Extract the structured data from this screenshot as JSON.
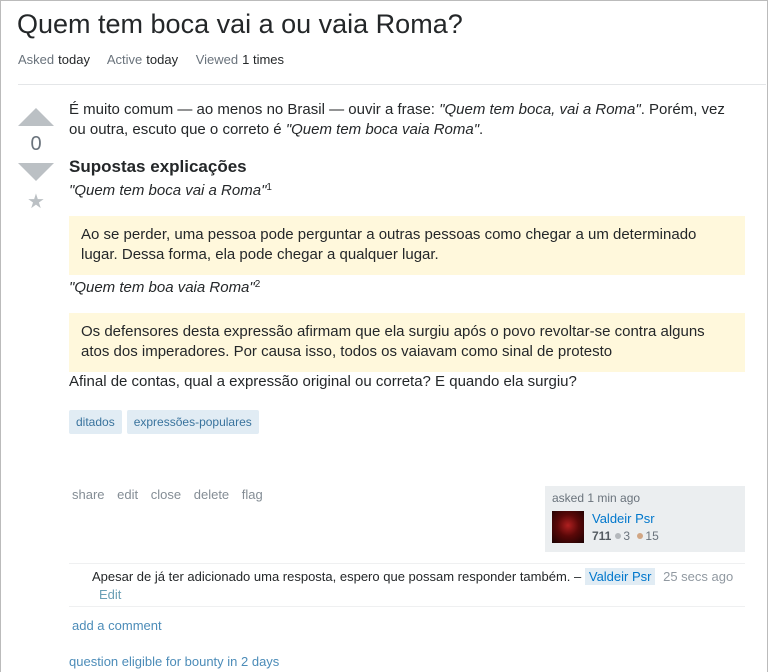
{
  "question": {
    "title": "Quem tem boca vai a ou vaia Roma?",
    "meta": [
      {
        "key": "Asked",
        "value": "today"
      },
      {
        "key": "Active",
        "value": "today"
      },
      {
        "key": "Viewed",
        "value": "1 times"
      }
    ],
    "votes": "0",
    "body": {
      "intro_prefix": "É muito comum — ao menos no Brasil — ouvir a frase: ",
      "intro_quote1": "\"Quem tem boca, vai a Roma\"",
      "intro_mid": ". Porém, vez ou outra, escuto que o correto é ",
      "intro_quote2": "\"Quem tem boca vaia Roma\"",
      "intro_end": ".",
      "heading": "Supostas explicações",
      "explanation1_label": "\"Quem tem boca vai a Roma\"",
      "explanation1_sup": "1",
      "explanation1_quote": "Ao se perder, uma pessoa pode perguntar a outras pessoas como chegar a um determinado lugar. Dessa forma, ela pode chegar a qualquer lugar.",
      "explanation2_label": "\"Quem tem boa vaia Roma\"",
      "explanation2_sup": "2",
      "explanation2_quote": "Os defensores desta expressão afirmam que ela surgiu após o povo revoltar-se contra alguns atos dos imperadores. Por causa isso, todos os vaiavam como sinal de protesto",
      "final": "Afinal de contas, qual a expressão original ou correta? E quando ela surgiu?"
    },
    "tags": [
      "ditados",
      "expressões-populares"
    ],
    "menu": [
      "share",
      "edit",
      "close",
      "delete",
      "flag"
    ],
    "owner": {
      "asked_text": "asked 1 min ago",
      "name": "Valdeir Psr",
      "reputation": "711",
      "silver": "3",
      "bronze": "15",
      "silver_color": "#b4b8bc",
      "bronze_color": "#d1a684"
    }
  },
  "comment": {
    "text": "Apesar de já ter adicionado uma resposta, espero que possam responder também. –",
    "user": "Valdeir Psr",
    "time": "25 secs ago",
    "edit": "Edit"
  },
  "add_comment": "add a comment",
  "bounty_notice": "question eligible for bounty in 2 days"
}
